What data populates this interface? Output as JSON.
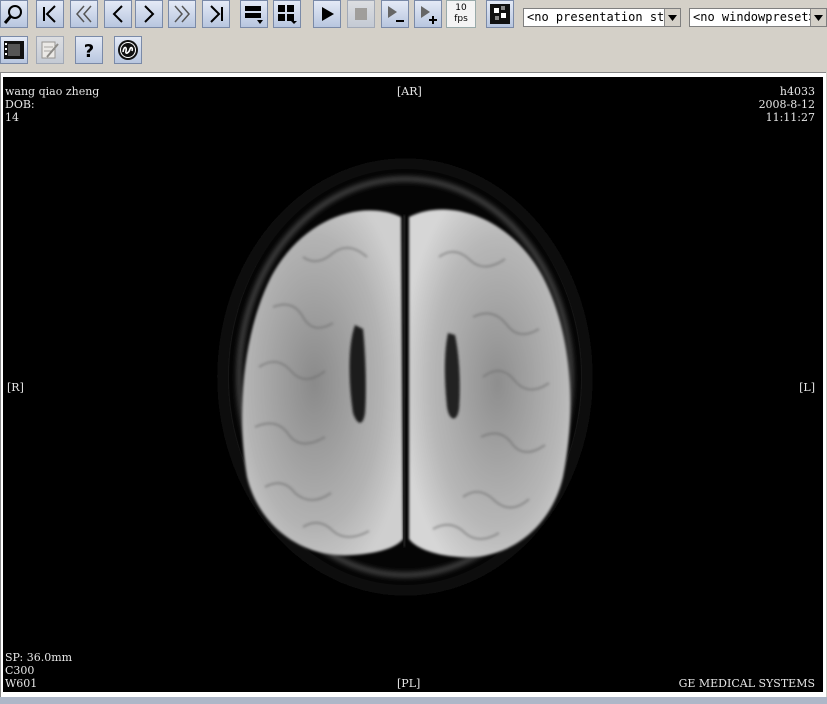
{
  "toolbar": {
    "fps_value": "10",
    "fps_unit": "fps",
    "presentation_select": "<no presentation st:",
    "windowpreset_select": "<no windowpreset>"
  },
  "icons": [
    "zoom-icon",
    "first-frame-icon",
    "fast-back-icon",
    "prev-icon",
    "next-icon",
    "fast-forward-icon",
    "last-frame-icon",
    "layout-icon",
    "grid-layout-icon",
    "play-icon",
    "stop-icon",
    "step-minus-icon",
    "step-plus-icon",
    "puzzle-icon",
    "film-icon",
    "notes-icon",
    "help-icon",
    "ge-logo-icon"
  ],
  "overlay": {
    "top_left": [
      "wang qiao zheng",
      "DOB:",
      "14"
    ],
    "top_center": "[AR]",
    "top_right": [
      "h4033",
      "2008-8-12",
      "11:11:27"
    ],
    "left_mid": "[R]",
    "right_mid": "[L]",
    "bottom_left": [
      "SP: 36.0mm",
      "C300",
      "W601"
    ],
    "bottom_center": "[PL]",
    "bottom_right": "GE MEDICAL SYSTEMS"
  },
  "colors": {
    "toolbar_bg": "#d4d0c8",
    "viewer_bg": "#000000",
    "overlay_text": "#e6e6e6"
  }
}
